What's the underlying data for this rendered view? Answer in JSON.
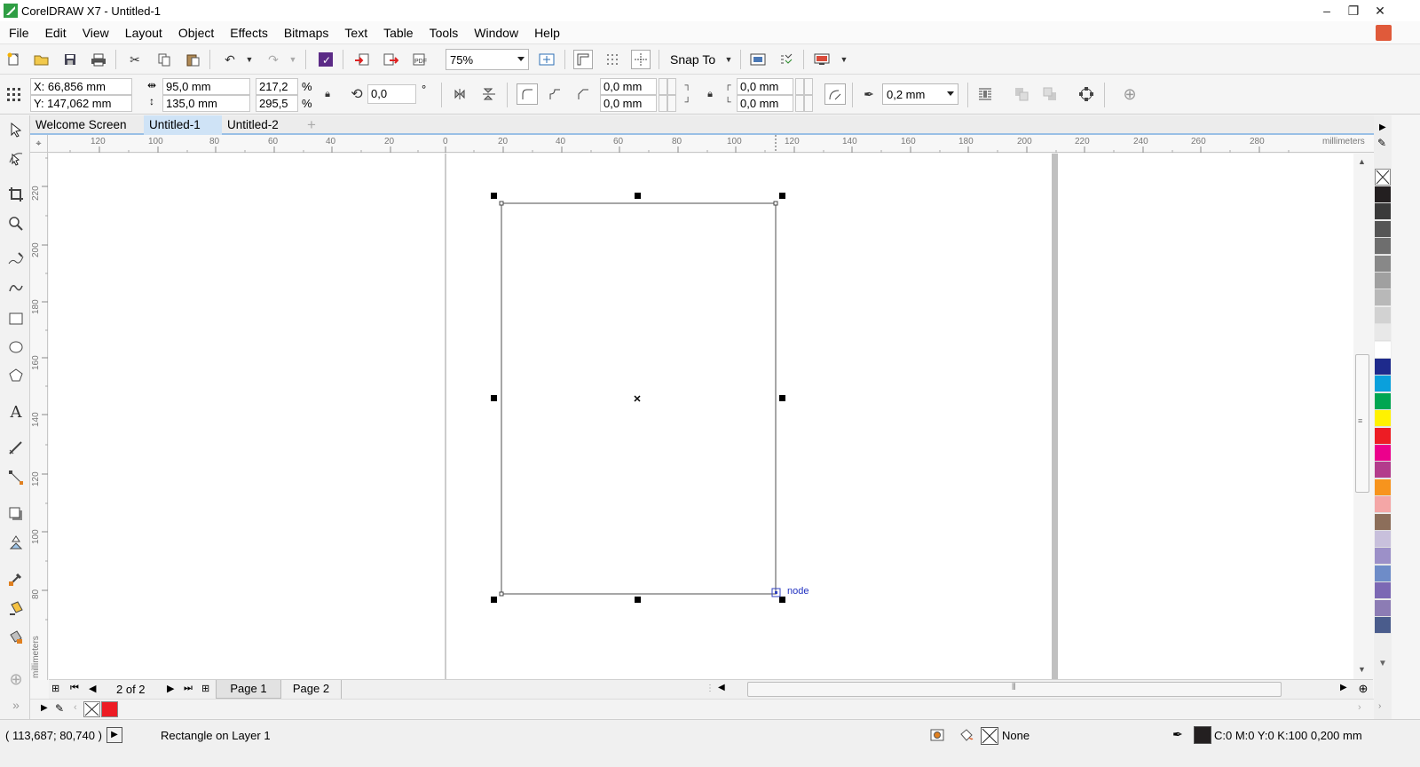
{
  "window": {
    "title": "CorelDRAW X7 - Untitled-1",
    "minimize_glyph": "–",
    "restore_glyph": "❐",
    "close_glyph": "✕"
  },
  "menu": [
    {
      "label": "File"
    },
    {
      "label": "Edit"
    },
    {
      "label": "View"
    },
    {
      "label": "Layout"
    },
    {
      "label": "Object"
    },
    {
      "label": "Effects"
    },
    {
      "label": "Bitmaps"
    },
    {
      "label": "Text"
    },
    {
      "label": "Table"
    },
    {
      "label": "Tools"
    },
    {
      "label": "Window"
    },
    {
      "label": "Help"
    }
  ],
  "standard_toolbar": {
    "zoom_level": "75%",
    "snap_to_label": "Snap To"
  },
  "property_bar": {
    "x_value": "X: 66,856 mm",
    "y_value": "Y: 147,062 mm",
    "width_value": "95,0 mm",
    "height_value": "135,0 mm",
    "scale_w": "217,2",
    "scale_h": "295,5",
    "percent_unit": "%",
    "rotation_value": "0,0",
    "degree_unit": "°",
    "corner_tl": "0,0 mm",
    "corner_bl": "0,0 mm",
    "corner_tr": "0,0 mm",
    "corner_br": "0,0 mm",
    "outline_width": "0,2 mm"
  },
  "doc_tabs": [
    {
      "label": "Welcome Screen"
    },
    {
      "label": "Untitled-1"
    },
    {
      "label": "Untitled-2"
    }
  ],
  "horizontal_ruler": {
    "ticks": [
      "120",
      "100",
      "80",
      "60",
      "40",
      "20",
      "0",
      "20",
      "40",
      "60",
      "80",
      "100",
      "120",
      "140",
      "160",
      "180",
      "200",
      "220",
      "240",
      "260",
      "280"
    ],
    "unit_label": "millimeters"
  },
  "vertical_ruler": {
    "ticks": [
      "220",
      "200",
      "180",
      "160",
      "140",
      "120",
      "100",
      "80"
    ],
    "unit_label": "millimeters"
  },
  "canvas": {
    "node_label": "node"
  },
  "page_nav": {
    "page_count": "2 of 2",
    "tabs": [
      {
        "label": "Page 1"
      },
      {
        "label": "Page 2"
      }
    ]
  },
  "palette_colors": [
    "#231f20",
    "#3a3a3a",
    "#555555",
    "#6e6e6e",
    "#888888",
    "#a0a0a0",
    "#b8b8b8",
    "#d2d2d2",
    "#e8e8e8",
    "#ffffff",
    "#1e2a8c",
    "#0aa0dc",
    "#00a651",
    "#fff200",
    "#ed1c24",
    "#ec008c",
    "#b33c8c",
    "#f7941d",
    "#f4a6a6",
    "#8c6e5a",
    "#c8c0dc",
    "#9c90c8",
    "#6e8cc8",
    "#7c68b4",
    "#8c7cb4",
    "#4a5c8c"
  ],
  "doc_palette_color": "#ed1c24",
  "status": {
    "cursor_coords": "( 113,687; 80,740 )",
    "selection_info": "Rectangle on Layer 1",
    "fill_label": "None",
    "outline_info": "C:0 M:0 Y:0 K:100  0,200 mm",
    "outline_color": "#231f20"
  }
}
